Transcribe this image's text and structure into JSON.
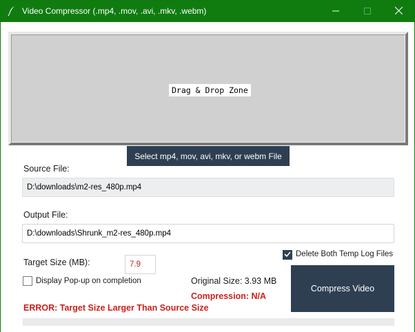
{
  "window": {
    "title": "Video Compressor (.mp4, .mov, .avi, .mkv, .webm)",
    "titlebar_color": "#107c10",
    "controls": [
      "minimize-icon",
      "maximize-icon",
      "close-icon"
    ]
  },
  "dropzone": {
    "label": "Drag & Drop Zone"
  },
  "select_button": {
    "label": "Select mp4, mov, avi, mkv, or webm File"
  },
  "source": {
    "label": "Source File:",
    "value": "D:\\downloads\\m2-res_480p.mp4"
  },
  "output": {
    "label": "Output File:",
    "value": "D:\\downloads\\Shrunk_m2-res_480p.mp4"
  },
  "target": {
    "label": "Target Size (MB):",
    "value": "7.9"
  },
  "delete_logs": {
    "label": "Delete Both Temp Log Files",
    "checked": true
  },
  "popup": {
    "label": "Display Pop-up on completion",
    "checked": false
  },
  "original_size": {
    "text": "Original Size: 3.93 MB"
  },
  "compression": {
    "text": "Compression: N/A"
  },
  "error": {
    "text": "ERROR: Target Size Larger Than Source Size"
  },
  "compress_button": {
    "label": "Compress Video"
  },
  "progress": {
    "value": 0
  },
  "colors": {
    "accent": "#2e3f52",
    "error": "#cc1f1a"
  }
}
